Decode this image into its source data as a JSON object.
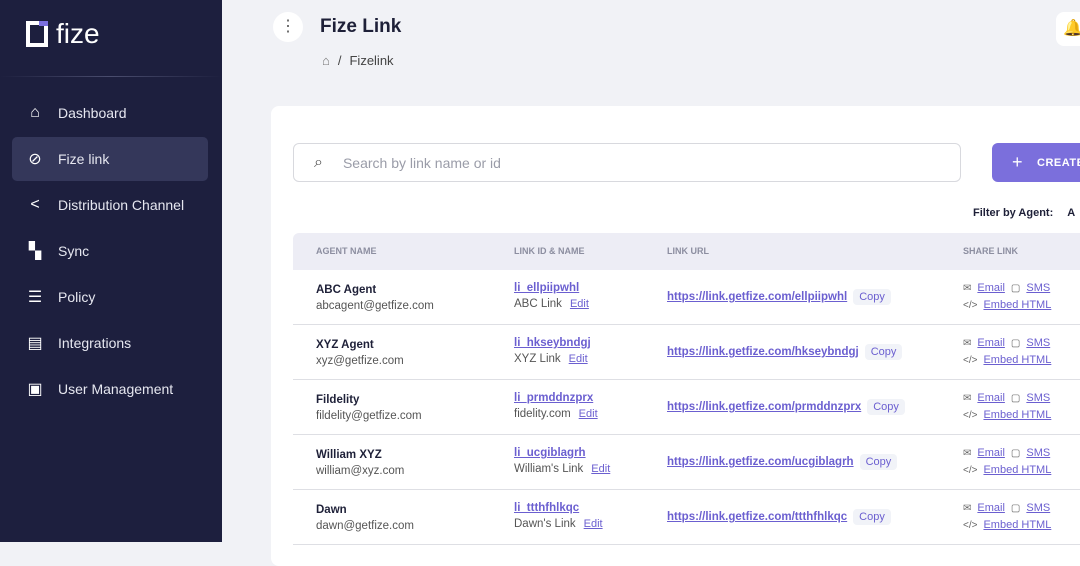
{
  "brand": "fize",
  "nav": [
    {
      "label": "Dashboard",
      "icon": "home-icon",
      "glyph": "⌂"
    },
    {
      "label": "Fize link",
      "icon": "link-icon",
      "glyph": "⊘",
      "active": true
    },
    {
      "label": "Distribution Channel",
      "icon": "share-icon",
      "glyph": "<"
    },
    {
      "label": "Sync",
      "icon": "sync-icon",
      "glyph": "▚"
    },
    {
      "label": "Policy",
      "icon": "list-icon",
      "glyph": "☰"
    },
    {
      "label": "Integrations",
      "icon": "integrations-icon",
      "glyph": "▤"
    },
    {
      "label": "User Management",
      "icon": "users-icon",
      "glyph": "▣"
    }
  ],
  "header": {
    "title": "Fize Link",
    "breadcrumb": [
      "Fizelink"
    ]
  },
  "search": {
    "placeholder": "Search by link name or id"
  },
  "create_label": "CREATE",
  "filter": {
    "label": "Filter by Agent:",
    "value": "A"
  },
  "columns": [
    "AGENT NAME",
    "LINK ID & NAME",
    "LINK URL",
    "SHARE LINK"
  ],
  "rows": [
    {
      "agent": "ABC Agent",
      "email": "abcagent@getfize.com",
      "id": "li_ellpiipwhl",
      "name": "ABC Link",
      "url": "https://link.getfize.com/ellpiipwhl"
    },
    {
      "agent": "XYZ Agent",
      "email": "xyz@getfize.com",
      "id": "li_hkseybndgj",
      "name": "XYZ Link",
      "url": "https://link.getfize.com/hkseybndgj"
    },
    {
      "agent": "Fildelity",
      "email": "fildelity@getfize.com",
      "id": "li_prmddnzprx",
      "name": "fidelity.com",
      "url": "https://link.getfize.com/prmddnzprx"
    },
    {
      "agent": "William XYZ",
      "email": "william@xyz.com",
      "id": "li_ucgiblagrh",
      "name": "William's Link",
      "url": "https://link.getfize.com/ucgiblagrh"
    },
    {
      "agent": "Dawn",
      "email": "dawn@getfize.com",
      "id": "li_ttthfhlkqc",
      "name": "Dawn's Link",
      "url": "https://link.getfize.com/ttthfhlkqc"
    }
  ],
  "labels": {
    "edit": "Edit",
    "copy": "Copy",
    "email": "Email",
    "sms": "SMS",
    "embed": "Embed HTML"
  }
}
